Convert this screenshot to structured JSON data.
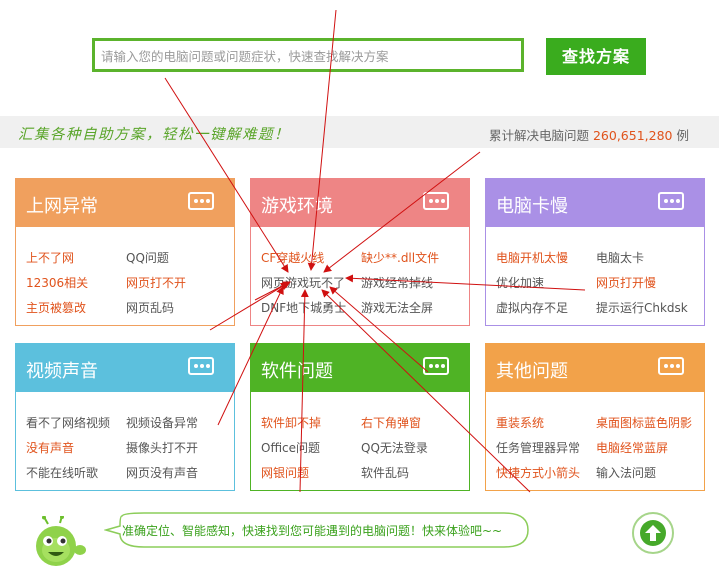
{
  "search": {
    "placeholder": "请输入您的电脑问题或问题症状，快速查找解决方案",
    "button_label": "查找方案"
  },
  "banner": {
    "slogan": "汇集各种自助方案，轻松一键解难题！",
    "solved_prefix": "累计解决电脑问题",
    "solved_count": "260,651,280",
    "solved_suffix": "例"
  },
  "cards": [
    {
      "title": "上网异常",
      "color": "#f0a05e",
      "links": [
        {
          "text": "上不了网",
          "hot": true
        },
        {
          "text": "QQ问题",
          "hot": false
        },
        {
          "text": "12306相关",
          "hot": true
        },
        {
          "text": "网页打不开",
          "hot": true
        },
        {
          "text": "主页被篡改",
          "hot": true
        },
        {
          "text": "网页乱码",
          "hot": false
        }
      ]
    },
    {
      "title": "游戏环境",
      "color": "#ee8585",
      "links": [
        {
          "text": "CF穿越火线",
          "hot": true
        },
        {
          "text": "缺少**.dll文件",
          "hot": true
        },
        {
          "text": "网页游戏玩不了",
          "hot": false
        },
        {
          "text": "游戏经常掉线",
          "hot": false
        },
        {
          "text": "DNF地下城勇士",
          "hot": false
        },
        {
          "text": "游戏无法全屏",
          "hot": false
        }
      ]
    },
    {
      "title": "电脑卡慢",
      "color": "#aa90e6",
      "links": [
        {
          "text": "电脑开机太慢",
          "hot": true
        },
        {
          "text": "电脑太卡",
          "hot": false
        },
        {
          "text": "优化加速",
          "hot": false
        },
        {
          "text": "网页打开慢",
          "hot": true
        },
        {
          "text": "虚拟内存不足",
          "hot": false
        },
        {
          "text": "提示运行Chkdsk",
          "hot": false
        }
      ]
    },
    {
      "title": "视频声音",
      "color": "#5cc0dd",
      "links": [
        {
          "text": "看不了网络视频",
          "hot": false
        },
        {
          "text": "视频设备异常",
          "hot": false
        },
        {
          "text": "没有声音",
          "hot": true
        },
        {
          "text": "摄像头打不开",
          "hot": false
        },
        {
          "text": "不能在线听歌",
          "hot": false
        },
        {
          "text": "网页没有声音",
          "hot": false
        }
      ]
    },
    {
      "title": "软件问题",
      "color": "#4fb325",
      "links": [
        {
          "text": "软件卸不掉",
          "hot": true
        },
        {
          "text": "右下角弹窗",
          "hot": true
        },
        {
          "text": "Office问题",
          "hot": false
        },
        {
          "text": "QQ无法登录",
          "hot": false
        },
        {
          "text": "网银问题",
          "hot": true
        },
        {
          "text": "软件乱码",
          "hot": false
        }
      ]
    },
    {
      "title": "其他问题",
      "color": "#f2a24a",
      "links": [
        {
          "text": "重装系统",
          "hot": true
        },
        {
          "text": "桌面图标蓝色阴影",
          "hot": true
        },
        {
          "text": "任务管理器异常",
          "hot": false
        },
        {
          "text": "电脑经常蓝屏",
          "hot": true
        },
        {
          "text": "快捷方式小箭头",
          "hot": true
        },
        {
          "text": "输入法问题",
          "hot": false
        }
      ]
    }
  ],
  "bottom": {
    "bubble_text": "准确定位、智能感知，快速找到您可能遇到的电脑问题！快来体验吧~~",
    "mascot_icon": "green-mascot-icon",
    "top_icon": "arrow-up-icon"
  }
}
